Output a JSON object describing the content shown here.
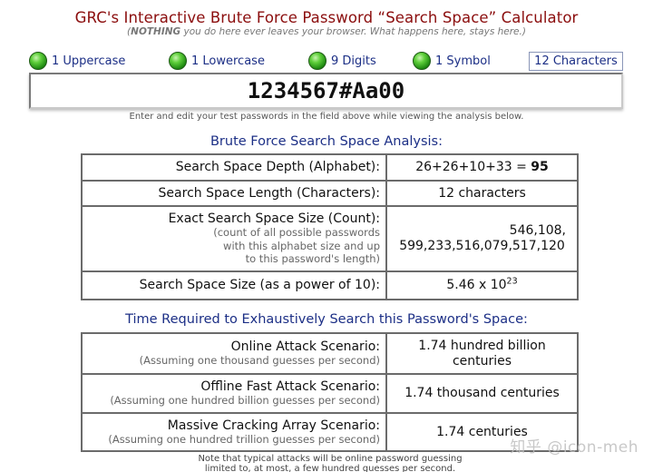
{
  "header": {
    "title": "GRC's Interactive Brute Force Password “Search Space” Calculator",
    "subtitle_emphasis": "NOTHING",
    "subtitle_rest": " you do here ever leaves your browser. What happens here, stays here.)"
  },
  "indicators": [
    {
      "label": "1 Uppercase",
      "status": "on"
    },
    {
      "label": "1 Lowercase",
      "status": "on"
    },
    {
      "label": "9 Digits",
      "status": "on"
    },
    {
      "label": "1 Symbol",
      "status": "on"
    }
  ],
  "char_count": "12 Characters",
  "password": {
    "value": "1234567#Aa00"
  },
  "hint": "Enter and edit your test passwords in the field above while viewing the analysis below.",
  "search_space": {
    "heading": "Brute Force Search Space Analysis:",
    "depth_label": "Search Space Depth (Alphabet):",
    "depth_expr": "26+26+10+33 = ",
    "depth_total": "95",
    "length_label": "Search Space Length (Characters):",
    "length_value": "12 characters",
    "count_label": "Exact Search Space Size (Count):",
    "count_note_1": "(count of all possible passwords",
    "count_note_2": "with this alphabet size and up",
    "count_note_3": "to this password's length)",
    "count_value_1": "546,108,",
    "count_value_2": "599,233,516,079,517,120",
    "power_label": "Search Space Size (as a power of 10):",
    "power_base": "5.46 x 10",
    "power_exp": "23"
  },
  "time_required": {
    "heading": "Time Required to Exhaustively Search this Password's Space:",
    "online_label": "Online Attack Scenario:",
    "online_note": "(Assuming one thousand guesses per second)",
    "online_value_1": "1.74 hundred billion",
    "online_value_2": "centuries",
    "offline_label": "Offline Fast Attack Scenario:",
    "offline_note": "(Assuming one hundred billion guesses per second)",
    "offline_value": "1.74 thousand centuries",
    "massive_label": "Massive Cracking Array Scenario:",
    "massive_note": "(Assuming one hundred trillion guesses per second)",
    "massive_value": "1.74 centuries"
  },
  "footnote": {
    "line1": "Note that typical attacks will be online password guessing",
    "line2": "limited to, at most, a few hundred guesses per second."
  },
  "watermark": "知乎 @icon-meh"
}
